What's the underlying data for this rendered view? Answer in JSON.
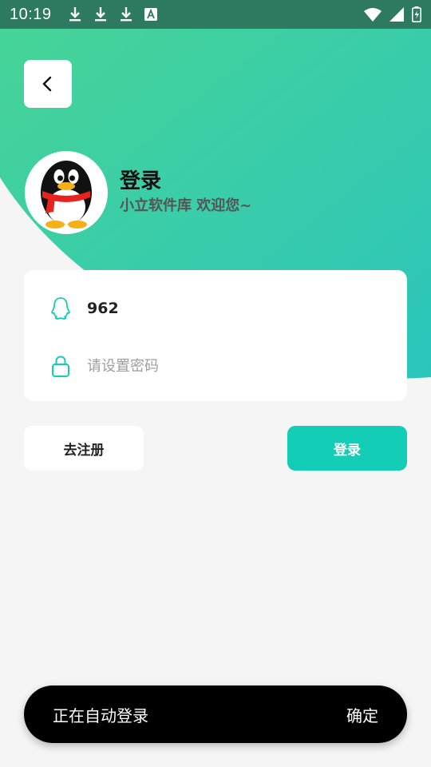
{
  "status_bar": {
    "time": "10:19",
    "left_icons": [
      "download-icon",
      "download-icon",
      "download-icon",
      "app-notification-icon"
    ],
    "right_icons": [
      "wifi-icon",
      "cell-signal-icon",
      "battery-charging-icon"
    ]
  },
  "header": {
    "back_icon": "chevron-left-icon",
    "title": "登录",
    "subtitle": "小立软件库 欢迎您~"
  },
  "form": {
    "account_icon": "qq-icon",
    "account_value": "962",
    "password_icon": "lock-icon",
    "password_placeholder": "请设置密码"
  },
  "actions": {
    "register_label": "去注册",
    "login_label": "登录"
  },
  "snackbar": {
    "message": "正在自动登录",
    "action_label": "确定"
  },
  "colors": {
    "accent": "#14cdb6",
    "gradient_start": "#46d497",
    "gradient_end": "#2cc5bc",
    "status_bar": "#2e7a60",
    "background": "#f5f5f5"
  }
}
